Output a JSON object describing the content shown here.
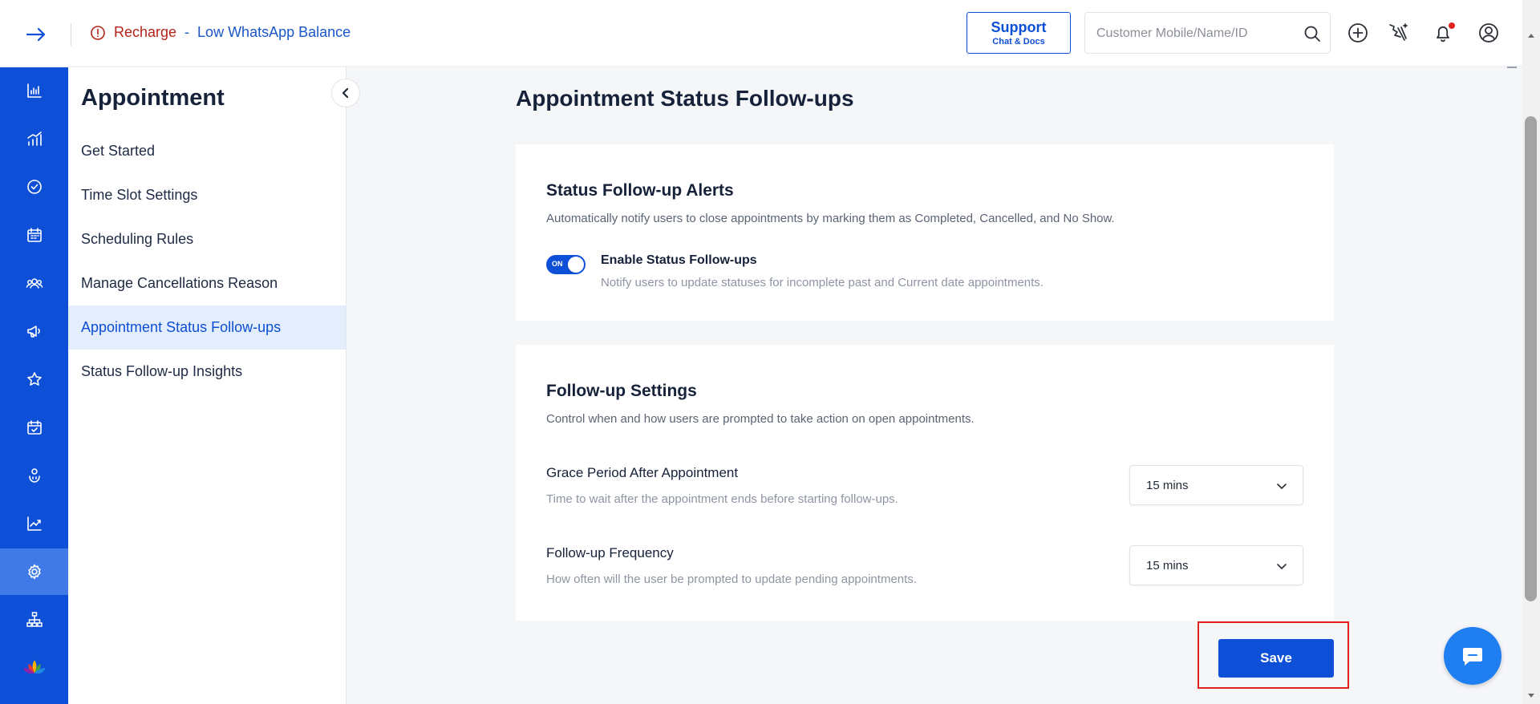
{
  "topbar": {
    "recharge_text": "Recharge",
    "separator": "-",
    "recharge_link": "Low WhatsApp Balance",
    "support_main": "Support",
    "support_sub": "Chat & Docs",
    "search_placeholder": "Customer Mobile/Name/ID",
    "search_value": ""
  },
  "leftnav": {
    "icons": [
      "bar-chart-icon",
      "growth-chart-icon",
      "check-circle-icon",
      "calendar-icon",
      "group-icon",
      "megaphone-icon",
      "star-icon",
      "calendar-check-icon",
      "hand-coin-icon",
      "trend-icon",
      "gear-icon",
      "org-chart-icon",
      "lotus-logo-icon"
    ],
    "active_index": 10
  },
  "subnav": {
    "title": "Appointment",
    "items": [
      {
        "label": "Get Started"
      },
      {
        "label": "Time Slot Settings"
      },
      {
        "label": "Scheduling Rules"
      },
      {
        "label": "Manage Cancellations Reason"
      },
      {
        "label": "Appointment Status Follow-ups"
      },
      {
        "label": "Status Follow-up Insights"
      }
    ],
    "active_index": 4
  },
  "main": {
    "page_title": "Appointment Status Follow-ups",
    "alerts_card": {
      "title": "Status Follow-up Alerts",
      "description": "Automatically notify users to close appointments by marking them as Completed, Cancelled, and No Show.",
      "toggle_state": "ON",
      "toggle_title": "Enable Status Follow-ups",
      "toggle_description": "Notify users to update statuses for incomplete past and Current date appointments."
    },
    "settings_card": {
      "title": "Follow-up Settings",
      "description": "Control when and how users are prompted to take action on open appointments.",
      "grace_label": "Grace Period After Appointment",
      "grace_description": "Time to wait after the appointment ends before starting follow-ups.",
      "grace_value": "15 mins",
      "frequency_label": "Follow-up Frequency",
      "frequency_description": "How often will the user be prompted to update pending appointments.",
      "frequency_value": "15 mins"
    },
    "save_label": "Save"
  },
  "colors": {
    "brand": "#0d4fd6",
    "active_nav": "#3f7ae6",
    "highlight": "#e02020",
    "warning": "#b42318"
  }
}
